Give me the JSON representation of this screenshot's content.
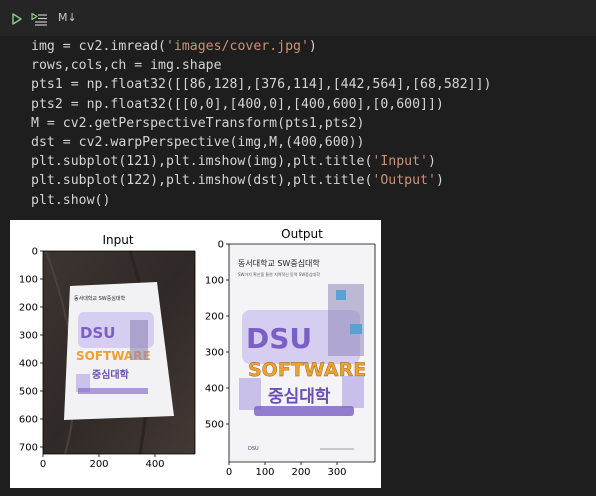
{
  "toolbar": {
    "run_icon": "play-icon",
    "run_below_icon": "run-below-icon",
    "markdown_label": "M↓"
  },
  "code": {
    "lines": [
      [
        {
          "t": "img = cv2.imread("
        },
        {
          "t": "'images/cover.jpg'",
          "s": 1
        },
        {
          "t": ")"
        }
      ],
      [
        {
          "t": "rows,cols,ch = img.shape"
        }
      ],
      [
        {
          "t": "pts1 = np.float32([[86,128],[376,114],[442,564],[68,582]])"
        }
      ],
      [
        {
          "t": "pts2 = np.float32([[0,0],[400,0],[400,600],[0,600]])"
        }
      ],
      [
        {
          "t": "M = cv2.getPerspectiveTransform(pts1,pts2)"
        }
      ],
      [
        {
          "t": "dst = cv2.warpPerspective(img,M,(400,600))"
        }
      ],
      [
        {
          "t": "plt.subplot(121),plt.imshow(img),plt.title("
        },
        {
          "t": "'Input'",
          "s": 1
        },
        {
          "t": ")"
        }
      ],
      [
        {
          "t": "plt.subplot(122),plt.imshow(dst),plt.title("
        },
        {
          "t": "'Output'",
          "s": 1
        },
        {
          "t": ")"
        }
      ],
      [
        {
          "t": "plt.show()"
        }
      ]
    ]
  },
  "output": {
    "input_plot": {
      "title": "Input",
      "y_ticks": [
        "0",
        "100",
        "200",
        "300",
        "400",
        "500",
        "600",
        "700"
      ],
      "x_ticks": [
        "0",
        "200",
        "400"
      ],
      "cover_text": {
        "line1": "동서대학교 SW중심대학",
        "big1": "DSU",
        "big2": "SOFTWARE",
        "big3": "중심대학"
      }
    },
    "output_plot": {
      "title": "Output",
      "y_ticks": [
        "0",
        "100",
        "200",
        "300",
        "400",
        "500"
      ],
      "x_ticks": [
        "0",
        "100",
        "200",
        "300"
      ],
      "cover_text": {
        "line1": "동서대학교 SW중심대학",
        "line2": "SW가치 확산을 통한 지역혁신 동력 SW중심대학",
        "big1": "DSU",
        "big2": "SOFTWARE",
        "big3": "중심대학",
        "footer": "DSU"
      }
    }
  },
  "colors": {
    "string": "#ce9178",
    "text": "#d4d4d4",
    "background": "#1e1e1e",
    "toolbar": "#252526",
    "cover_purple": "#7a5fc4",
    "cover_orange": "#f0a030",
    "table_wood": "#3a3230"
  }
}
